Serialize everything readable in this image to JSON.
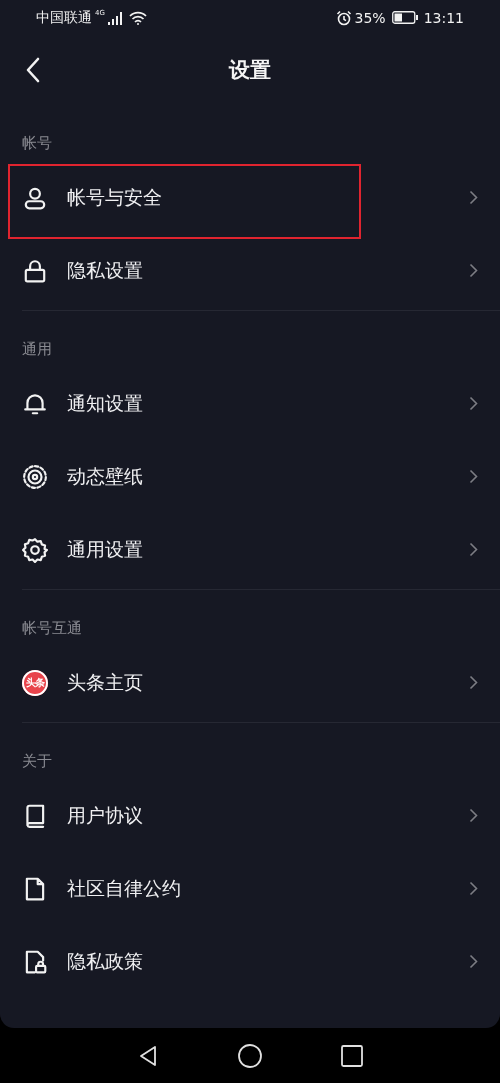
{
  "status_bar": {
    "carrier": "中国联通",
    "network": "4G",
    "battery": "35%",
    "time": "13:11"
  },
  "header": {
    "title": "设置"
  },
  "sections": [
    {
      "label": "帐号",
      "items": [
        {
          "kind": "user",
          "label": "帐号与安全",
          "highlighted": true
        },
        {
          "kind": "lock",
          "label": "隐私设置",
          "highlighted": false
        }
      ]
    },
    {
      "label": "通用",
      "items": [
        {
          "kind": "bell",
          "label": "通知设置",
          "highlighted": false
        },
        {
          "kind": "live",
          "label": "动态壁纸",
          "highlighted": false
        },
        {
          "kind": "gear",
          "label": "通用设置",
          "highlighted": false
        }
      ]
    },
    {
      "label": "帐号互通",
      "items": [
        {
          "kind": "badge",
          "badge": "头条",
          "label": "头条主页",
          "highlighted": false
        }
      ]
    },
    {
      "label": "关于",
      "items": [
        {
          "kind": "book",
          "label": "用户协议",
          "highlighted": false
        },
        {
          "kind": "file",
          "label": "社区自律公约",
          "highlighted": false
        },
        {
          "kind": "filelock",
          "label": "隐私政策",
          "highlighted": false
        }
      ]
    }
  ]
}
